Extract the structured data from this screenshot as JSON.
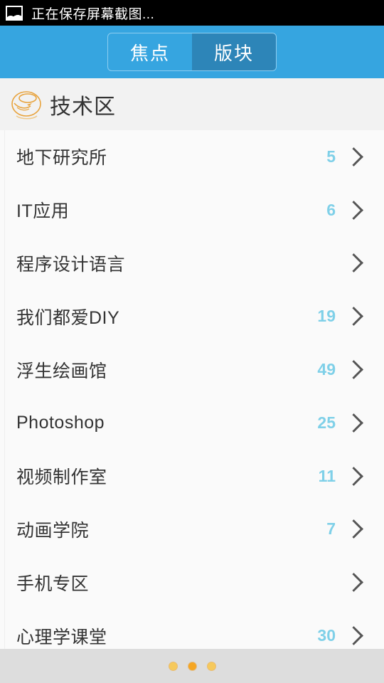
{
  "status_bar": {
    "icon": "image-icon",
    "text": "正在保存屏幕截图..."
  },
  "header": {
    "tabs": [
      {
        "label": "焦点",
        "active": false
      },
      {
        "label": "版块",
        "active": true
      }
    ]
  },
  "section": {
    "icon": "forum-globe-icon",
    "title": "技术区"
  },
  "list": {
    "rows": [
      {
        "label": "地下研究所",
        "count": "5"
      },
      {
        "label": "IT应用",
        "count": "6"
      },
      {
        "label": "程序设计语言",
        "count": ""
      },
      {
        "label": "我们都爱DIY",
        "count": "19"
      },
      {
        "label": "浮生绘画馆",
        "count": "49"
      },
      {
        "label": "Photoshop",
        "count": "25"
      },
      {
        "label": "视频制作室",
        "count": "11"
      },
      {
        "label": "动画学院",
        "count": "7"
      },
      {
        "label": "手机专区",
        "count": ""
      },
      {
        "label": "心理学课堂",
        "count": "30"
      }
    ]
  },
  "pagination": {
    "dots": [
      {
        "active": false
      },
      {
        "active": true
      },
      {
        "active": false
      }
    ]
  },
  "colors": {
    "header_blue": "#36a5e0",
    "tab_active_blue": "#2d85b8",
    "count_blue": "#7fd0e8",
    "section_bg": "#f2f2f2",
    "list_bg": "#fafafa",
    "dot_orange": "#f5a623",
    "bottom_bar": "#dddddd"
  }
}
